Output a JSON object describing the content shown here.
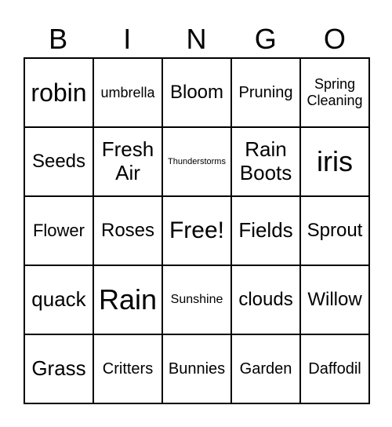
{
  "header": [
    "B",
    "I",
    "N",
    "G",
    "O"
  ],
  "cells": [
    "robin",
    "umbrella",
    "Bloom",
    "Pruning",
    "Spring Cleaning",
    "Seeds",
    "Fresh Air",
    "Thunderstorms",
    "Rain Boots",
    "iris",
    "Flower",
    "Roses",
    "Free!",
    "Fields",
    "Sprout",
    "quack",
    "Rain",
    "Sunshine",
    "clouds",
    "Willow",
    "Grass",
    "Critters",
    "Bunnies",
    "Garden",
    "Daffodil"
  ]
}
